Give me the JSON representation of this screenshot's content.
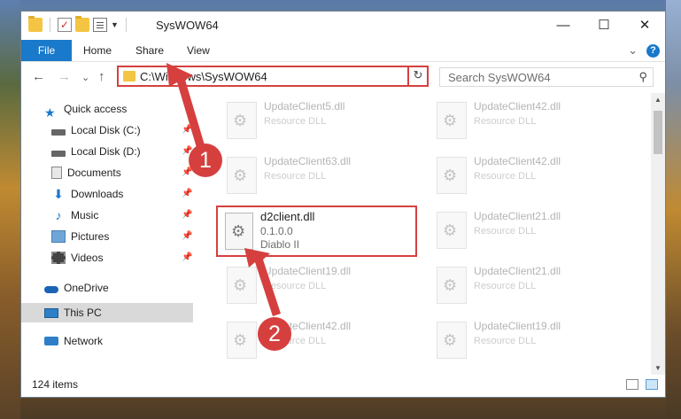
{
  "window": {
    "title": "SysWOW64"
  },
  "window_controls": {
    "minimize": "—",
    "maximize": "☐",
    "close": "✕"
  },
  "ribbon": {
    "file": "File",
    "tabs": [
      "Home",
      "Share",
      "View"
    ],
    "expand": "⌄",
    "help": "?"
  },
  "nav": {
    "back": "←",
    "forward": "→",
    "recent": "⌄",
    "up": "↑"
  },
  "address": {
    "path": "C:\\Windows\\SysWOW64",
    "dropdown": "⌄",
    "refresh": "↻"
  },
  "search": {
    "placeholder": "Search SysWOW64",
    "icon": "search-icon"
  },
  "sidebar": {
    "items": [
      {
        "label": "Quick access",
        "icon": "star-icon",
        "pinned": false
      },
      {
        "label": "Local Disk (C:)",
        "icon": "drive-icon",
        "pinned": true
      },
      {
        "label": "Local Disk (D:)",
        "icon": "drive-icon",
        "pinned": true
      },
      {
        "label": "Documents",
        "icon": "documents-icon",
        "pinned": true
      },
      {
        "label": "Downloads",
        "icon": "downloads-icon",
        "pinned": true
      },
      {
        "label": "Music",
        "icon": "music-icon",
        "pinned": true
      },
      {
        "label": "Pictures",
        "icon": "pictures-icon",
        "pinned": true
      },
      {
        "label": "Videos",
        "icon": "videos-icon",
        "pinned": true
      },
      {
        "label": "OneDrive",
        "icon": "onedrive-icon",
        "pinned": false
      },
      {
        "label": "This PC",
        "icon": "this-pc-icon",
        "pinned": false,
        "selected": true
      },
      {
        "label": "Network",
        "icon": "network-icon",
        "pinned": false
      }
    ]
  },
  "files": [
    {
      "name": "UpdateClient5.dll",
      "desc": "Resource DLL"
    },
    {
      "name": "UpdateClient42.dll",
      "desc": "Resource DLL"
    },
    {
      "name": "UpdateClient63.dll",
      "desc": "Resource DLL"
    },
    {
      "name": "UpdateClient42.dll",
      "desc": "Resource DLL"
    },
    {
      "name": "UpdateClient21.dll",
      "desc": "Resource DLL"
    },
    {
      "name": "UpdateClient19.dll",
      "desc": "Resource DLL"
    },
    {
      "name": "UpdateClient21.dll",
      "desc": "Resource DLL"
    },
    {
      "name": "UpdateClient42.dll",
      "desc": "Resource DLL"
    },
    {
      "name": "UpdateClient19.dll",
      "desc": "Resource DLL"
    }
  ],
  "highlighted_file": {
    "name": "d2client.dll",
    "version": "0.1.0.0",
    "desc": "Diablo II"
  },
  "status": {
    "item_count": "124 items"
  },
  "annotations": {
    "step1": "1",
    "step2": "2",
    "color": "#d5403f"
  }
}
